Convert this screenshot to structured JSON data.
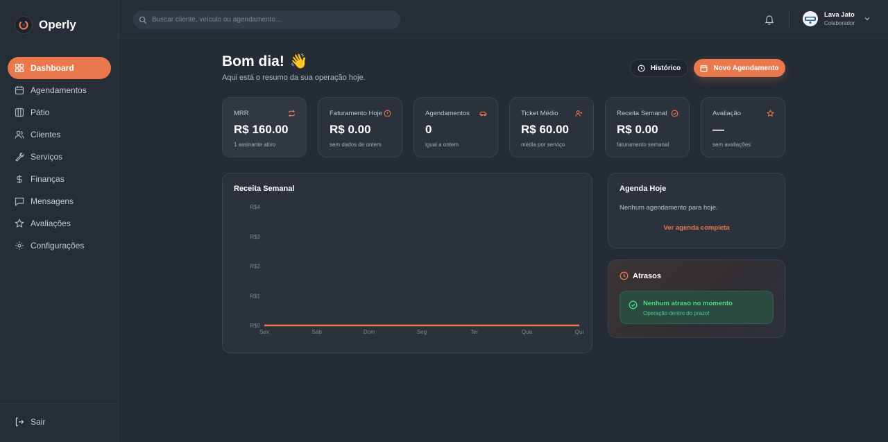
{
  "app": {
    "name": "Operly"
  },
  "sidebar": {
    "items": [
      {
        "label": "Dashboard",
        "icon": "dashboard-icon",
        "active": true
      },
      {
        "label": "Agendamentos",
        "icon": "calendar-icon"
      },
      {
        "label": "Pátio",
        "icon": "columns-icon"
      },
      {
        "label": "Clientes",
        "icon": "users-icon"
      },
      {
        "label": "Serviços",
        "icon": "wrench-icon"
      },
      {
        "label": "Finanças",
        "icon": "dollar-icon"
      },
      {
        "label": "Mensagens",
        "icon": "message-icon"
      },
      {
        "label": "Avaliações",
        "icon": "star-icon"
      },
      {
        "label": "Configurações",
        "icon": "gear-icon"
      }
    ],
    "logout_label": "Sair"
  },
  "topbar": {
    "search_placeholder": "Buscar cliente, veículo ou agendamento...",
    "user": {
      "name": "Lava Jato",
      "role": "Colaborador"
    }
  },
  "header": {
    "greeting": "Bom dia!",
    "emoji": "👋",
    "subtitle": "Aqui está o resumo da sua operação hoje.",
    "history_label": "Histórico",
    "new_label": "Novo Agendamento"
  },
  "stats": [
    {
      "label": "MRR",
      "value": "R$ 160.00",
      "sub": "1 assinante ativo",
      "icon": "repeat-icon"
    },
    {
      "label": "Faturamento Hoje",
      "value": "R$ 0.00",
      "sub": "sem dados de ontem",
      "icon": "alert-circle-icon"
    },
    {
      "label": "Agendamentos",
      "value": "0",
      "sub": "igual a ontem",
      "icon": "car-icon"
    },
    {
      "label": "Ticket Médio",
      "value": "R$ 60.00",
      "sub": "média por serviço",
      "icon": "user-plus-icon"
    },
    {
      "label": "Receita Semanal",
      "value": "R$ 0.00",
      "sub": "faturamento semanal",
      "icon": "check-circle-icon"
    },
    {
      "label": "Avaliação",
      "value": "—",
      "sub": "sem avaliações",
      "icon": "star-icon"
    }
  ],
  "chart_panel": {
    "title": "Receita Semanal"
  },
  "chart_data": {
    "type": "line",
    "categories": [
      "Sex",
      "Sáb",
      "Dom",
      "Seg",
      "Ter",
      "Qua",
      "Qui"
    ],
    "series": [
      {
        "values": [
          0,
          0,
          0,
          0,
          0,
          0,
          0
        ]
      }
    ],
    "y_ticks": [
      "R$0",
      "R$1",
      "R$2",
      "R$3",
      "R$4"
    ],
    "ylim": [
      0,
      4
    ],
    "grid": false,
    "line_color": "#e9784d"
  },
  "agenda": {
    "title": "Agenda Hoje",
    "empty_text": "Nenhum agendamento para hoje.",
    "link_label": "Ver agenda completa"
  },
  "atrasos": {
    "title": "Atrasos",
    "ok_title": "Nenhum atraso no momento",
    "ok_sub": "Operação dentro do prazo!"
  },
  "colors": {
    "accent": "#e9784d",
    "success": "#4ade80"
  }
}
